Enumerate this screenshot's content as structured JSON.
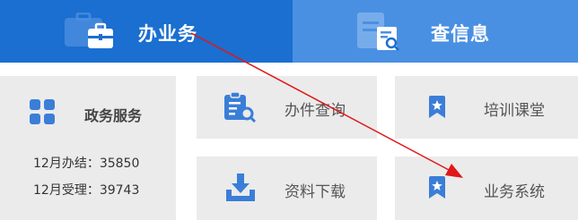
{
  "tabs": {
    "banshi": {
      "label": "办业务",
      "icon": "briefcase-icon",
      "color": "#1a6fd0"
    },
    "chaxun": {
      "label": "查信息",
      "icon": "document-search-icon",
      "color": "#4a90e2"
    }
  },
  "cards": {
    "gov_services": {
      "title": "政务服务",
      "icon": "grid-icon",
      "stats": [
        {
          "label": "12月办结：",
          "value": "35850"
        },
        {
          "label": "12月受理：",
          "value": "39743"
        }
      ]
    },
    "query": {
      "label": "办件查询",
      "icon": "clipboard-search-icon"
    },
    "training": {
      "label": "培训课堂",
      "icon": "bookmark-star-icon"
    },
    "download": {
      "label": "资料下载",
      "icon": "download-tray-icon"
    },
    "system": {
      "label": "业务系统",
      "icon": "bookmark-star-icon"
    }
  },
  "colors": {
    "accent": "#1a6fd0",
    "icon_blue": "#3a7ed8",
    "card_bg": "#ebebeb",
    "annotation_arrow": "#e01818"
  }
}
